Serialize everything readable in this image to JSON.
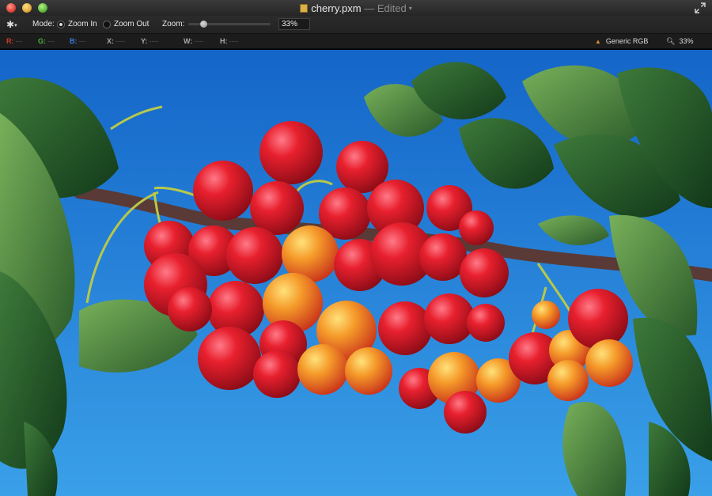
{
  "window": {
    "filename": "cherry.pxm",
    "separator": "—",
    "status": "Edited"
  },
  "toolbar": {
    "mode_label": "Mode:",
    "zoom_in_label": "Zoom In",
    "zoom_out_label": "Zoom Out",
    "selected_mode": "Zoom In",
    "zoom_label": "Zoom:",
    "zoom_value": "33%",
    "zoom_slider_fraction": 0.18
  },
  "infobar": {
    "r": {
      "key": "R:",
      "value": "---"
    },
    "g": {
      "key": "G:",
      "value": "---"
    },
    "b": {
      "key": "B:",
      "value": "---"
    },
    "x": {
      "key": "X:",
      "value": "----"
    },
    "y": {
      "key": "Y:",
      "value": "----"
    },
    "w": {
      "key": "W:",
      "value": "----"
    },
    "h": {
      "key": "H:",
      "value": "----"
    },
    "color_profile": "Generic RGB",
    "zoom_readout": "33%"
  },
  "image": {
    "subject": "cherries on branch",
    "sky_top": "#1465c8",
    "sky_bottom": "#3aa0e8"
  }
}
